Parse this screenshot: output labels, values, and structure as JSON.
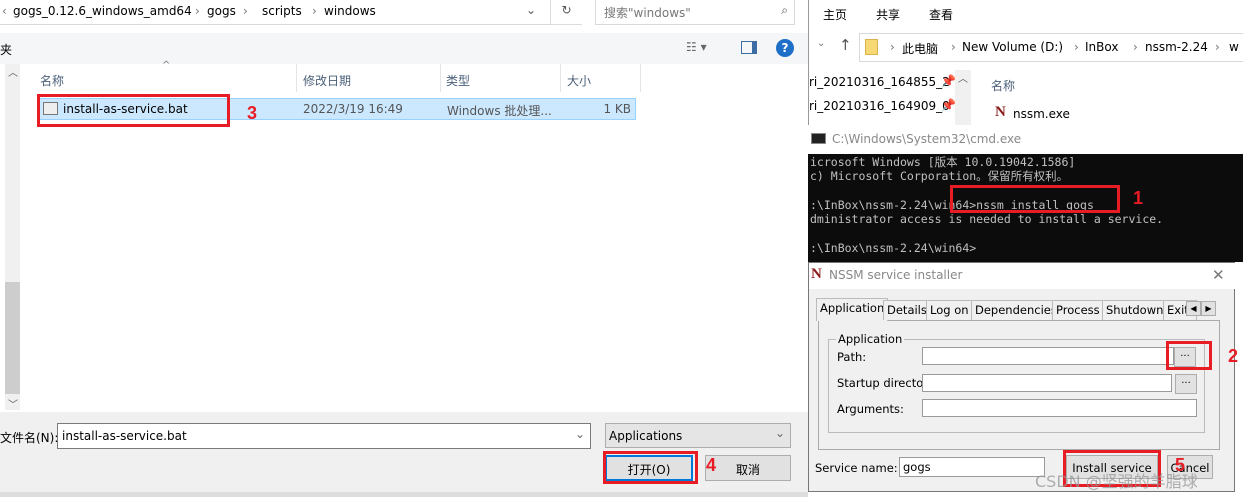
{
  "file_dialog": {
    "breadcrumb": [
      "gogs_0.12.6_windows_amd64",
      "gogs",
      "scripts",
      "windows"
    ],
    "search_placeholder": "搜索\"windows\"",
    "sidebar_partial": "夹",
    "columns": [
      "名称",
      "修改日期",
      "类型",
      "大小"
    ],
    "rows": [
      {
        "name": "install-as-service.bat",
        "modified": "2022/3/19 16:49",
        "type": "Windows 批处理...",
        "size": "1 KB"
      }
    ],
    "filename_label": "文件名(N):",
    "filename_value": "install-as-service.bat",
    "filter_value": "Applications",
    "open_label": "打开(O)",
    "cancel_label": "取消"
  },
  "explorer": {
    "ribbon_tabs": [
      "主页",
      "共享",
      "查看"
    ],
    "breadcrumb": [
      "此电脑",
      "New Volume (D:)",
      "InBox",
      "nssm-2.24",
      "w"
    ],
    "nav_items": [
      "ri_20210316_164855_2",
      "ri_20210316_164909_0"
    ],
    "column": "名称",
    "file": "nssm.exe"
  },
  "cmd": {
    "title": "C:\\Windows\\System32\\cmd.exe",
    "lines": [
      "icrosoft Windows [版本 10.0.19042.1586]",
      "c) Microsoft Corporation。保留所有权利。",
      "",
      ":\\InBox\\nssm-2.24\\win64>nssm install gogs",
      "dministrator access is needed to install a service.",
      "",
      ":\\InBox\\nssm-2.24\\win64>"
    ]
  },
  "nssm": {
    "title": "NSSM service installer",
    "tabs": [
      "Application",
      "Details",
      "Log on",
      "Dependencies",
      "Process",
      "Shutdown",
      "Exit"
    ],
    "group": "Application",
    "path_label": "Path:",
    "startup_label": "Startup directory:",
    "args_label": "Arguments:",
    "browse": "...",
    "service_name_label": "Service name:",
    "service_name_value": "gogs",
    "install_label": "Install service",
    "cancel_label": "Cancel"
  },
  "annotations": [
    "1",
    "2",
    "3",
    "4",
    "5"
  ],
  "watermark": "CSDN @坚强的羊脂球"
}
